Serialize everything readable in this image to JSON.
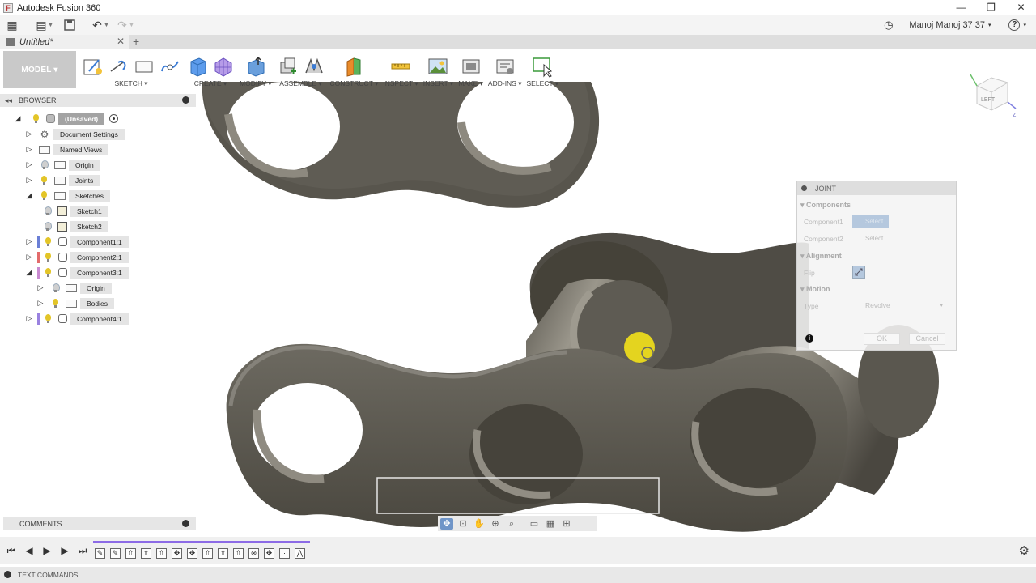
{
  "window": {
    "title": "Autodesk Fusion 360",
    "controls": [
      "—",
      "❐",
      "✕"
    ]
  },
  "appbar": {
    "user": "Manoj Manoj 37 37",
    "user_caret": "▾",
    "help": "?"
  },
  "tab": {
    "title": "Untitled*",
    "close": "✕",
    "add": "+"
  },
  "toolbar": {
    "workspace": "MODEL ▾",
    "groups": [
      {
        "label": "SKETCH ▾"
      },
      {
        "label": "CREATE ▾"
      },
      {
        "label": "MODIFY ▾"
      },
      {
        "label": "ASSEMBLE ▾"
      },
      {
        "label": "CONSTRUCT ▾"
      },
      {
        "label": "INSPECT ▾"
      },
      {
        "label": "INSERT ▾"
      },
      {
        "label": "MAKE ▾"
      },
      {
        "label": "ADD-INS ▾"
      },
      {
        "label": "SELECT ▾"
      }
    ]
  },
  "browser": {
    "title": "BROWSER",
    "items": [
      {
        "label": "(Unsaved)"
      },
      {
        "label": "Document Settings"
      },
      {
        "label": "Named Views"
      },
      {
        "label": "Origin"
      },
      {
        "label": "Joints"
      },
      {
        "label": "Sketches"
      },
      {
        "label": "Sketch1"
      },
      {
        "label": "Sketch2"
      },
      {
        "label": "Component1:1"
      },
      {
        "label": "Component2:1"
      },
      {
        "label": "Component3:1"
      },
      {
        "label": "Origin"
      },
      {
        "label": "Bodies"
      },
      {
        "label": "Component4:1"
      }
    ]
  },
  "comments": {
    "title": "COMMENTS"
  },
  "joint_dialog": {
    "title": "JOINT",
    "sections": {
      "components": "Components",
      "alignment": "Alignment",
      "motion": "Motion"
    },
    "component1_label": "Component1",
    "component2_label": "Component2",
    "select_text": "Select",
    "flip_label": "Flip",
    "type_label": "Type",
    "type_value": "Revolve",
    "ok": "OK",
    "cancel": "Cancel"
  },
  "viewcube": {
    "face": "LEFT",
    "axis_z": "Z"
  },
  "text_commands": {
    "title": "TEXT COMMANDS"
  },
  "colors": {
    "model_button": "#c9c9c9",
    "selected_node": "#a3a3a3",
    "timeline_progress": "#8c6be6",
    "component1": "#6b7fd6",
    "component2": "#e36b6b",
    "component3": "#c98ad1",
    "component4": "#9a82e0",
    "part_dark": "#4d4a43",
    "part_light": "#8a867b"
  }
}
